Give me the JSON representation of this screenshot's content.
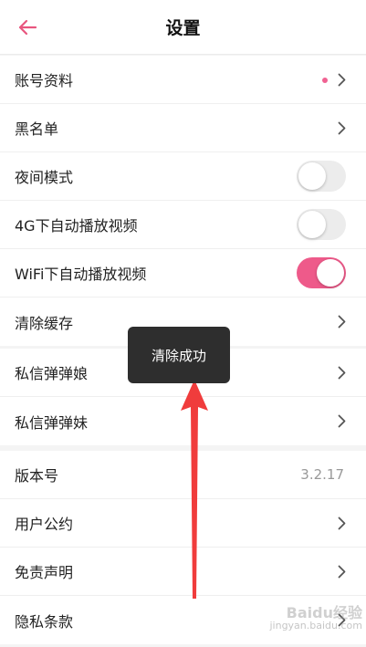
{
  "header": {
    "title": "设置",
    "back_icon": "arrow-left-icon",
    "accent": "#e8567f"
  },
  "group1": {
    "account": {
      "label": "账号资料"
    },
    "blacklist": {
      "label": "黑名单"
    },
    "night_mode": {
      "label": "夜间模式",
      "enabled": false
    },
    "autoplay_4g": {
      "label": "4G下自动播放视频",
      "enabled": false
    },
    "autoplay_wifi": {
      "label": "WiFi下自动播放视频",
      "enabled": true
    },
    "clear_cache": {
      "label": "清除缓存"
    }
  },
  "group2": {
    "dm_niang": {
      "label": "私信弹弹娘"
    },
    "dm_mei": {
      "label": "私信弹弹妹"
    }
  },
  "group3": {
    "version": {
      "label": "版本号",
      "value": "3.2.17"
    },
    "user_agreement": {
      "label": "用户公约"
    },
    "disclaimer": {
      "label": "免责声明"
    },
    "privacy": {
      "label": "隐私条款"
    }
  },
  "toast": {
    "text": "清除成功"
  },
  "annotation_color": "#f03c3c",
  "toggle_on_color": "#ee5a8a",
  "watermark": {
    "line1": "Baidu经验",
    "line2": "jingyan.baidu.com"
  }
}
